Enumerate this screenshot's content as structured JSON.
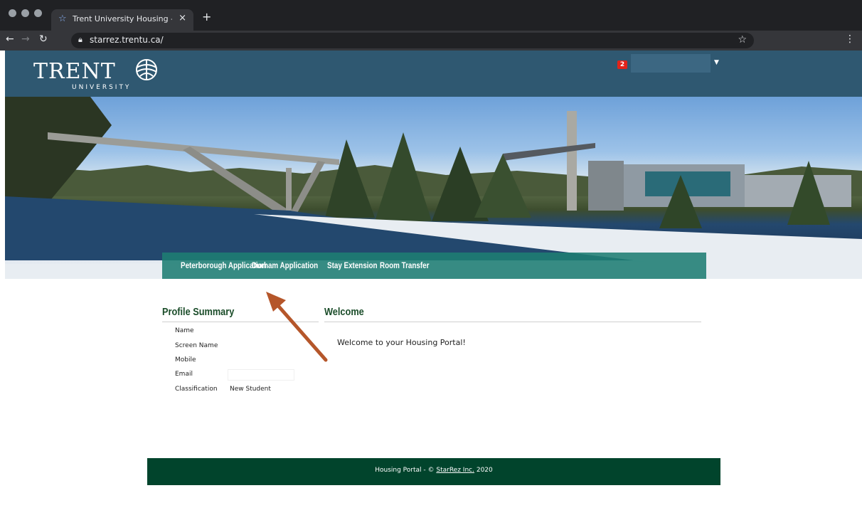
{
  "browser": {
    "tab_title": "Trent University Housing - Wel",
    "url": "starrez.trentu.ca/"
  },
  "header": {
    "logo_text": "TRENT",
    "logo_subtext": "UNIVERSITY",
    "notification_count": "2"
  },
  "nav": {
    "items": [
      {
        "label": "Peterborough Application"
      },
      {
        "label": "Durham Application"
      },
      {
        "label": "Stay Extension"
      },
      {
        "label": "Room Transfer"
      }
    ]
  },
  "profile": {
    "title": "Profile Summary",
    "fields": [
      {
        "label": "Name",
        "value": ""
      },
      {
        "label": "Screen Name",
        "value": ""
      },
      {
        "label": "Mobile",
        "value": ""
      },
      {
        "label": "Email",
        "value": ""
      },
      {
        "label": "Classification",
        "value": "New Student"
      }
    ]
  },
  "welcome": {
    "title": "Welcome",
    "message": "Welcome to your Housing Portal!"
  },
  "footer": {
    "prefix": "Housing Portal - © ",
    "link": "StarRez Inc.",
    "suffix": " 2020"
  },
  "colors": {
    "header_bg": "#2f5871",
    "nav_bg": "#1e7d73",
    "title_green": "#1b4d2a",
    "footer_bg": "#01442c",
    "arrow": "#b5562a"
  }
}
